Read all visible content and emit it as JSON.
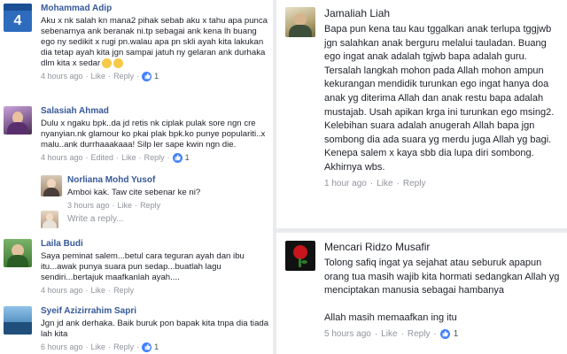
{
  "colors": {
    "link": "#365899",
    "meta": "#90949c",
    "like_blue": "#4080ff",
    "text": "#1d2129"
  },
  "left": {
    "comments": [
      {
        "name": "Mohammad Adip",
        "text": "Aku x nk salah kn mana2 pihak sebab aku x tahu apa punca sebenarnya ank beranak ni.tp sebagai ank kena lh buang ego ny sedikit x rugi pn.walau apa pn skli ayah kita lakukan dia tetap ayah kita jgn sampai jatuh ny gelaran ank durhaka dlm kita x sedar",
        "time": "4 hours ago",
        "like": "Like",
        "reply": "Reply",
        "count": "1",
        "avatar_label": "4"
      },
      {
        "name": "Salasiah Ahmad",
        "text": "Dulu x ngaku bpk..da jd retis nk ciplak pulak sore ngn cre nyanyian.nk glamour ko pkai plak bpk.ko punye populariti..x malu..ank durrhaaakaaa! Silp ler sape kwin ngn die.",
        "time": "4 hours ago",
        "edited": "Edited",
        "like": "Like",
        "reply": "Reply",
        "count": "1"
      },
      {
        "name": "Laila Budi",
        "text": "Saya peminat salem...betul cara teguran ayah dan ibu itu...awak punya suara pun sedap...buatlah lagu sendiri...bertajuk maafkanlah ayah....",
        "time": "4 hours ago",
        "like": "Like",
        "reply": "Reply"
      },
      {
        "name": "Syeif Azizirrahim Sapri",
        "text": "Jgn jd ank derhaka. Baik buruk pon bapak kita tnpa dia tiada lah kita",
        "time": "6 hours ago",
        "like": "Like",
        "reply": "Reply",
        "count": "1"
      }
    ],
    "reply": {
      "name": "Norliana Mohd Yusof",
      "text": "Amboi kak. Taw cite sebenar ke ni?",
      "time": "3 hours ago",
      "like": "Like",
      "reply": "Reply"
    },
    "write_reply_placeholder": "Write a reply..."
  },
  "right": {
    "comments": [
      {
        "name": "Jamaliah Liah",
        "text": "Bapa pun kena tau kau tggalkan anak terlupa tggjwb jgn salahkan anak berguru melalui tauladan.  Buang ego ingat anak adalah tgjwb bapa adalah guru. Tersalah langkah mohon pada Allah mohon ampun kekurangan mendidik turunkan ego ingat hanya doa anak yg diterima Allah dan anak restu bapa adalah mustajab. Usah apikan krga ini turunkan ego msing2. Kelebihan suara adalah anugerah  Allah bapa jgn sombong dia ada suara yg merdu juga Allah yg bagi. Kenepa salem x kaya sbb dia lupa diri sombong. Akhirnya wbs.",
        "time": "1 hour ago",
        "like": "Like",
        "reply": "Reply"
      },
      {
        "name": "Mencari Ridzo Musafir",
        "text": "Tolong safiq  ingat ya  sejahat atau seburuk apapun orang tua masih wajib kita hormati   sedangkan Allah yg menciptakan manusia sebagai hambanya\n\n Allah masih memaafkan  ing itu",
        "time": "5 hours ago",
        "like": "Like",
        "reply": "Reply",
        "count": "1"
      }
    ]
  }
}
